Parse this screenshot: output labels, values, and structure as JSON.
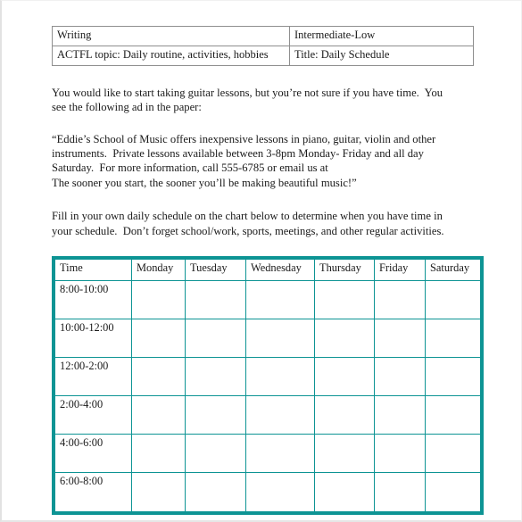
{
  "document": {
    "title": "Daily Schedule Worksheet",
    "accent_color": "#0d9494",
    "text_color": "#1a1a1a",
    "page_background": "#ffffff"
  },
  "meta_table": {
    "rows": [
      {
        "left": "Writing",
        "right": "Intermediate-Low"
      },
      {
        "left": "ACTFL topic:  Daily routine, activities, hobbies",
        "right": "Title: Daily Schedule"
      }
    ]
  },
  "prose": {
    "paragraph_1": {
      "lines": [
        "You would like to start taking guitar lessons, but you’re not sure if you have time.  You",
        "see the following ad in the paper:"
      ]
    },
    "paragraph_2": {
      "lines": [
        "“Eddie’s School of Music offers inexpensive lessons in piano, guitar, violin and other",
        "instruments.  Private lessons available between 3-8pm Monday- Friday and all day",
        "Saturday.  For more information, call 555-6785 or email us at",
        "The sooner you start, the sooner you’ll be making beautiful music!”"
      ]
    },
    "paragraph_3": {
      "lines": [
        "Fill in your own daily schedule on the chart below to determine when you have time in",
        "your schedule.  Don’t forget school/work, sports, meetings, and other regular activities."
      ]
    }
  },
  "schedule": {
    "headers": [
      "Time",
      "Monday",
      "Tuesday",
      "Wednesday",
      "Thursday",
      "Friday",
      "Saturday"
    ],
    "rows": [
      {
        "time": "8:00-10:00",
        "monday": "",
        "tuesday": "",
        "wednesday": "",
        "thursday": "",
        "friday": "",
        "saturday": ""
      },
      {
        "time": "10:00-12:00",
        "monday": "",
        "tuesday": "",
        "wednesday": "",
        "thursday": "",
        "friday": "",
        "saturday": ""
      },
      {
        "time": "12:00-2:00",
        "monday": "",
        "tuesday": "",
        "wednesday": "",
        "thursday": "",
        "friday": "",
        "saturday": ""
      },
      {
        "time": "2:00-4:00",
        "monday": "",
        "tuesday": "",
        "wednesday": "",
        "thursday": "",
        "friday": "",
        "saturday": ""
      },
      {
        "time": "4:00-6:00",
        "monday": "",
        "tuesday": "",
        "wednesday": "",
        "thursday": "",
        "friday": "",
        "saturday": ""
      },
      {
        "time": "6:00-8:00",
        "monday": "",
        "tuesday": "",
        "wednesday": "",
        "thursday": "",
        "friday": "",
        "saturday": ""
      }
    ]
  }
}
